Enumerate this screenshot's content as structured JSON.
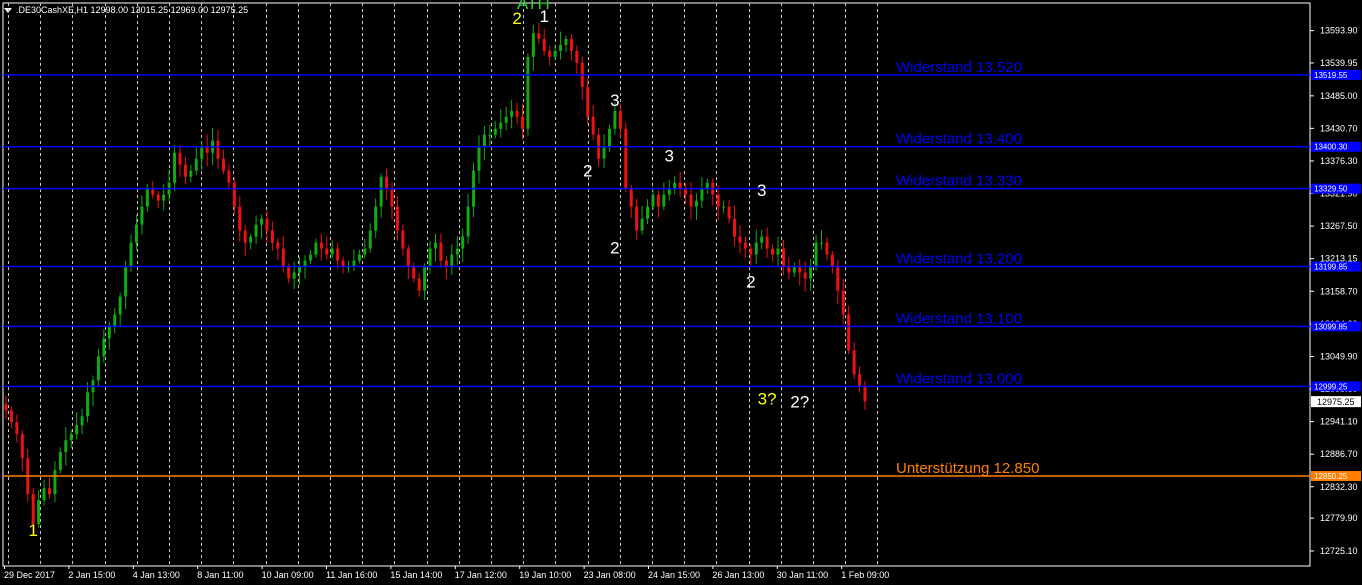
{
  "header": {
    "symbol_line": ".DE30CashXE,H1  12998.00 13015.25 12969.00 12975.25"
  },
  "chart_data": {
    "type": "candlestick",
    "symbol": ".DE30CashXE,H1",
    "ohlc_current": {
      "open": 12998.0,
      "high": 13015.25,
      "low": 12969.0,
      "close": 12975.25
    },
    "ylim": [
      12700,
      13640
    ],
    "y_ticks": [
      13593.9,
      13539.95,
      13485.0,
      13430.7,
      13376.3,
      13321.9,
      13267.5,
      13213.15,
      13158.7,
      13104.3,
      13049.9,
      12995.5,
      12941.1,
      12886.7,
      12832.3,
      12779.9,
      12725.1
    ],
    "x_labels": [
      "29 Dec 2017",
      "2 Jan 15:00",
      "4 Jan 13:00",
      "8 Jan 11:00",
      "10 Jan 09:00",
      "11 Jan 16:00",
      "15 Jan 14:00",
      "17 Jan 12:00",
      "19 Jan 10:00",
      "23 Jan 08:00",
      "24 Jan 15:00",
      "26 Jan 13:00",
      "30 Jan 11:00",
      "1 Feb 09:00"
    ],
    "price_path": [
      12960,
      12940,
      12920,
      12880,
      12820,
      12770,
      12810,
      12830,
      12820,
      12860,
      12890,
      12910,
      12920,
      12935,
      12950,
      12990,
      13010,
      13050,
      13080,
      13100,
      13120,
      13150,
      13200,
      13240,
      13270,
      13300,
      13330,
      13320,
      13310,
      13320,
      13340,
      13390,
      13370,
      13350,
      13360,
      13380,
      13400,
      13390,
      13410,
      13380,
      13360,
      13340,
      13300,
      13260,
      13240,
      13250,
      13270,
      13280,
      13260,
      13240,
      13230,
      13200,
      13180,
      13190,
      13200,
      13210,
      13220,
      13240,
      13230,
      13220,
      13230,
      13210,
      13200,
      13200,
      13210,
      13220,
      13230,
      13260,
      13300,
      13350,
      13330,
      13300,
      13260,
      13230,
      13200,
      13180,
      13160,
      13200,
      13230,
      13240,
      13210,
      13200,
      13220,
      13230,
      13250,
      13300,
      13360,
      13400,
      13420,
      13420,
      13430,
      13440,
      13450,
      13460,
      13450,
      13430,
      13550,
      13590,
      13580,
      13560,
      13550,
      13560,
      13570,
      13580,
      13560,
      13540,
      13500,
      13450,
      13420,
      13380,
      13400,
      13430,
      13460,
      13430,
      13330,
      13300,
      13260,
      13280,
      13300,
      13320,
      13300,
      13320,
      13330,
      13340,
      13330,
      13320,
      13300,
      13310,
      13330,
      13340,
      13320,
      13300,
      13300,
      13280,
      13250,
      13240,
      13230,
      13220,
      13240,
      13250,
      13230,
      13220,
      13230,
      13200,
      13190,
      13200,
      13190,
      13180,
      13200,
      13240,
      13240,
      13220,
      13200,
      13160,
      13120,
      13060,
      13020,
      13000,
      12975
    ],
    "horizontal_levels": [
      {
        "label": "Widerstand 13.520",
        "value": 13520,
        "color": "#0000ff",
        "tag": "13519.55"
      },
      {
        "label": "Widerstand 13.400",
        "value": 13400,
        "color": "#0000ff",
        "tag": "13400.30"
      },
      {
        "label": "Widerstand 13.330",
        "value": 13330,
        "color": "#0000ff",
        "tag": "13329.50"
      },
      {
        "label": "Widerstand 13.200",
        "value": 13200,
        "color": "#0000ff",
        "tag": "13199.85"
      },
      {
        "label": "Widerstand 13.100",
        "value": 13100,
        "color": "#0000ff",
        "tag": "13099.85"
      },
      {
        "label": "Widerstand 13.000",
        "value": 13000,
        "color": "#0000ff",
        "tag": "12999.25"
      },
      {
        "label": "Unterstützung 12.850",
        "value": 12850.25,
        "color": "#ff8000",
        "tag": "12850.25"
      }
    ],
    "current_price_tag": "12975.25",
    "annotations": [
      {
        "text": "1",
        "color": "#ffff00",
        "candle": 5,
        "price": 12750
      },
      {
        "text": "ATH",
        "color": "#33cc33",
        "candle": 97,
        "price": 13630
      },
      {
        "text": "2",
        "color": "#ffff00",
        "candle": 94,
        "price": 13605
      },
      {
        "text": "1",
        "color": "#ffffff",
        "candle": 99,
        "price": 13608
      },
      {
        "text": "3",
        "color": "#ffffff",
        "candle": 112,
        "price": 13468
      },
      {
        "text": "2",
        "color": "#ffffff",
        "candle": 107,
        "price": 13350
      },
      {
        "text": "3",
        "color": "#ffffff",
        "candle": 122,
        "price": 13375
      },
      {
        "text": "2",
        "color": "#ffffff",
        "candle": 112,
        "price": 13222
      },
      {
        "text": "3",
        "color": "#ffffff",
        "candle": 139,
        "price": 13318
      },
      {
        "text": "2",
        "color": "#ffffff",
        "candle": 137,
        "price": 13165
      },
      {
        "text": "3?",
        "color": "#ffff00",
        "candle": 140,
        "price": 12970
      },
      {
        "text": "2?",
        "color": "#ffffff",
        "candle": 146,
        "price": 12965
      }
    ]
  }
}
